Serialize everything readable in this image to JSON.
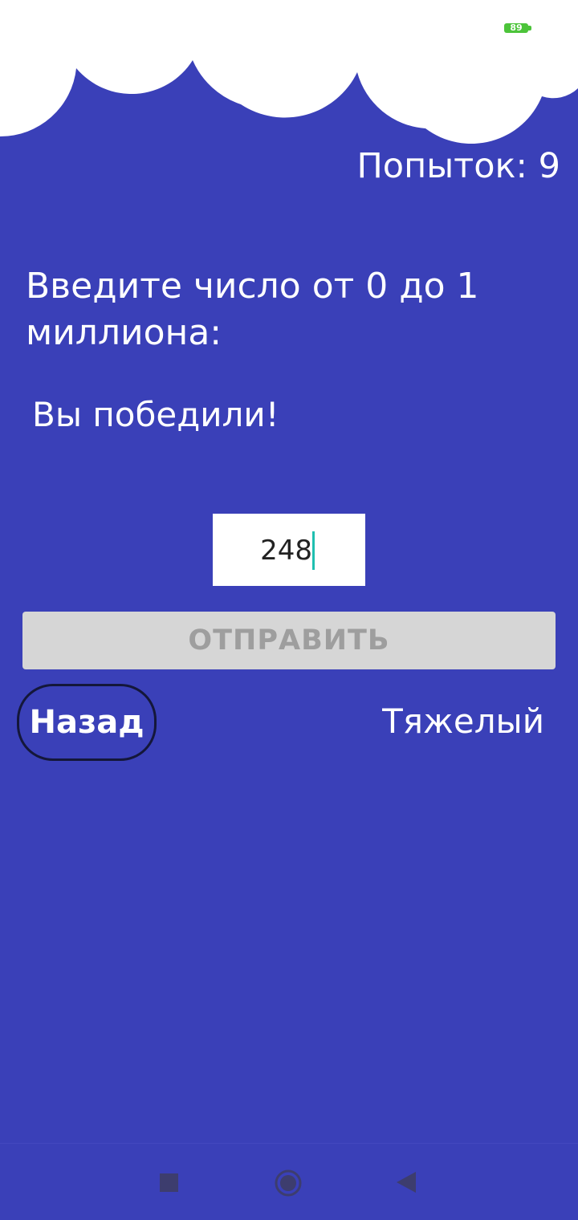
{
  "status_bar": {
    "battery_level": "89",
    "battery_icon": "battery-icon",
    "battery_color": "#4cc43a"
  },
  "header": {
    "attempts_label": "Попыток: 9"
  },
  "main": {
    "prompt": "Введите число от 0 до 1 миллиона:",
    "result_message": "Вы победили!",
    "number_input": {
      "value": "248"
    },
    "submit_label": "ОТПРАВИТЬ",
    "back_label": "Назад",
    "difficulty_label": "Тяжелый"
  },
  "nav_bar": {
    "recents_icon": "square-icon",
    "home_icon": "circle-home-icon",
    "back_icon": "triangle-back-icon"
  },
  "theme": {
    "background": "#3a40b8",
    "cloud": "#ffffff",
    "submit_disabled_bg": "#d6d6d6",
    "submit_disabled_text": "#9e9e9e",
    "cursor": "#1fbfb0"
  }
}
